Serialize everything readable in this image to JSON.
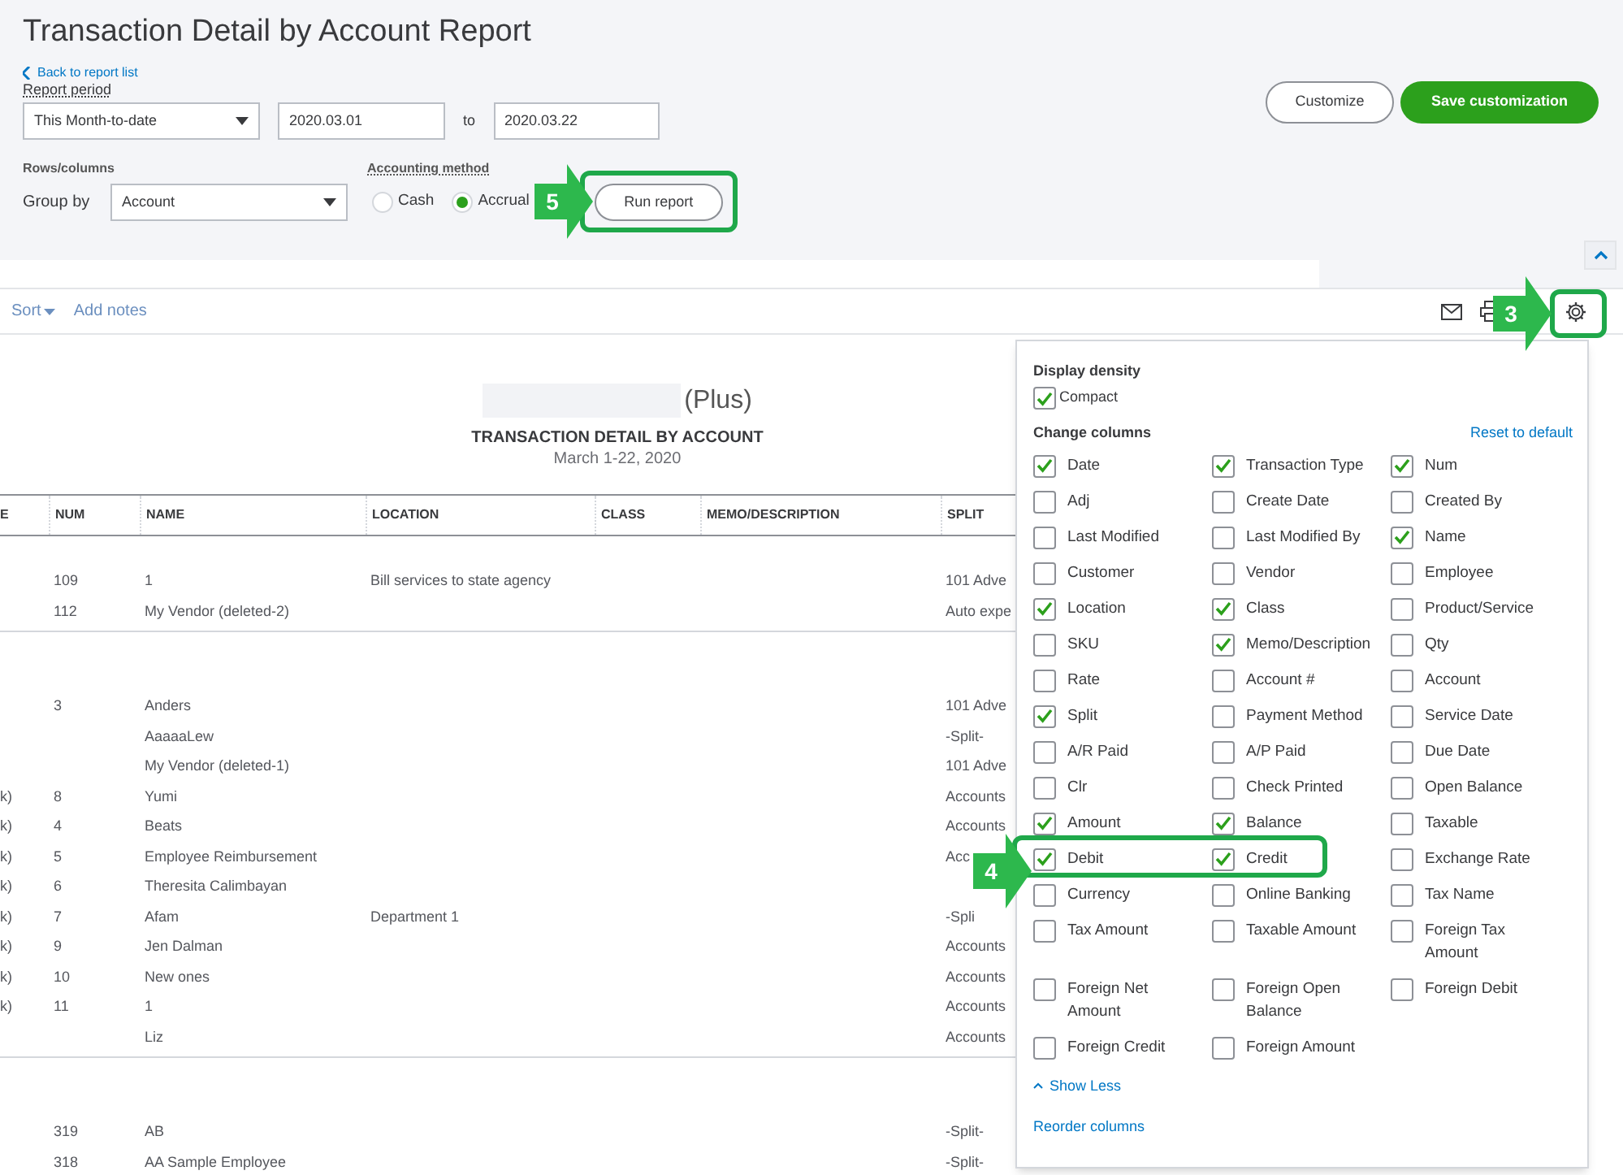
{
  "header": {
    "title": "Transaction Detail by Account Report",
    "back_link": "Back to report list",
    "report_period_label": "Report period",
    "period_select": "This Month-to-date",
    "date_from": "2020.03.01",
    "to_label": "to",
    "date_to": "2020.03.22",
    "rows_columns_label": "Rows/columns",
    "group_by_label": "Group by",
    "group_by_select": "Account",
    "accounting_method_label": "Accounting method",
    "methods": [
      {
        "label": "Cash",
        "selected": false
      },
      {
        "label": "Accrual",
        "selected": true
      }
    ],
    "run_report": "Run report",
    "customize": "Customize",
    "save_customization": "Save customization"
  },
  "toolbar": {
    "sort": "Sort",
    "add_notes": "Add notes"
  },
  "report": {
    "company_suffix": "(Plus)",
    "title": "TRANSACTION DETAIL BY ACCOUNT",
    "subtitle": "March 1-22, 2020"
  },
  "table": {
    "columns": [
      "E",
      "NUM",
      "NAME",
      "LOCATION",
      "CLASS",
      "MEMO/DESCRIPTION",
      "SPLIT"
    ],
    "groups": [
      {
        "rows": [
          [
            "",
            "109",
            "1",
            "Bill services to state agency",
            "",
            "",
            "101 Adve"
          ],
          [
            "",
            "112",
            "My Vendor (deleted-2)",
            "",
            "",
            "",
            "Auto expe"
          ]
        ]
      },
      {
        "rows": [
          [
            "",
            "3",
            "Anders",
            "",
            "",
            "",
            "101 Adve"
          ],
          [
            "",
            "",
            "AaaaaLew",
            "",
            "",
            "",
            "-Split-"
          ],
          [
            "",
            "",
            "My Vendor (deleted-1)",
            "",
            "",
            "",
            "101 Adve"
          ],
          [
            "k)",
            "8",
            "Yumi",
            "",
            "",
            "",
            "Accounts"
          ],
          [
            "k)",
            "4",
            "Beats",
            "",
            "",
            "",
            "Accounts"
          ],
          [
            "k)",
            "5",
            "Employee Reimbursement",
            "",
            "",
            "",
            "Acc"
          ],
          [
            "k)",
            "6",
            "Theresita Calimbayan",
            "",
            "",
            "",
            ""
          ],
          [
            "k)",
            "7",
            "Afam",
            "Department 1",
            "",
            "",
            "-Spli"
          ],
          [
            "k)",
            "9",
            "Jen Dalman",
            "",
            "",
            "",
            "Accounts"
          ],
          [
            "k)",
            "10",
            "New ones",
            "",
            "",
            "",
            "Accounts"
          ],
          [
            "k)",
            "11",
            "1",
            "",
            "",
            "",
            "Accounts"
          ],
          [
            "",
            "",
            "Liz",
            "",
            "",
            "",
            "Accounts"
          ]
        ]
      },
      {
        "rows": [
          [
            "",
            "319",
            "AB",
            "",
            "",
            "",
            "-Split-"
          ],
          [
            "",
            "318",
            "AA Sample Employee",
            "",
            "",
            "",
            "-Split-"
          ]
        ]
      }
    ]
  },
  "settings_popover": {
    "density_label": "Display density",
    "compact": {
      "label": "Compact",
      "checked": true
    },
    "change_columns_label": "Change columns",
    "reset": "Reset to default",
    "options": [
      {
        "label": "Date",
        "checked": true
      },
      {
        "label": "Transaction Type",
        "checked": true
      },
      {
        "label": "Num",
        "checked": true
      },
      {
        "label": "Adj",
        "checked": false
      },
      {
        "label": "Create Date",
        "checked": false
      },
      {
        "label": "Created By",
        "checked": false
      },
      {
        "label": "Last Modified",
        "checked": false
      },
      {
        "label": "Last Modified By",
        "checked": false
      },
      {
        "label": "Name",
        "checked": true
      },
      {
        "label": "Customer",
        "checked": false
      },
      {
        "label": "Vendor",
        "checked": false
      },
      {
        "label": "Employee",
        "checked": false
      },
      {
        "label": "Location",
        "checked": true
      },
      {
        "label": "Class",
        "checked": true
      },
      {
        "label": "Product/Service",
        "checked": false
      },
      {
        "label": "SKU",
        "checked": false
      },
      {
        "label": "Memo/Description",
        "checked": true
      },
      {
        "label": "Qty",
        "checked": false
      },
      {
        "label": "Rate",
        "checked": false
      },
      {
        "label": "Account #",
        "checked": false
      },
      {
        "label": "Account",
        "checked": false
      },
      {
        "label": "Split",
        "checked": true
      },
      {
        "label": "Payment Method",
        "checked": false
      },
      {
        "label": "Service Date",
        "checked": false
      },
      {
        "label": "A/R Paid",
        "checked": false
      },
      {
        "label": "A/P Paid",
        "checked": false
      },
      {
        "label": "Due Date",
        "checked": false
      },
      {
        "label": "Clr",
        "checked": false
      },
      {
        "label": "Check Printed",
        "checked": false
      },
      {
        "label": "Open Balance",
        "checked": false
      },
      {
        "label": "Amount",
        "checked": true
      },
      {
        "label": "Balance",
        "checked": true
      },
      {
        "label": "Taxable",
        "checked": false
      },
      {
        "label": "Debit",
        "checked": true
      },
      {
        "label": "Credit",
        "checked": true
      },
      {
        "label": "Exchange Rate",
        "checked": false
      },
      {
        "label": "Currency",
        "checked": false
      },
      {
        "label": "Online Banking",
        "checked": false
      },
      {
        "label": "Tax Name",
        "checked": false
      },
      {
        "label": "Tax Amount",
        "checked": false
      },
      {
        "label": "Taxable Amount",
        "checked": false
      },
      {
        "label": "Foreign Tax Amount",
        "checked": false
      },
      {
        "label": "Foreign Net Amount",
        "checked": false
      },
      {
        "label": "Foreign Open Balance",
        "checked": false
      },
      {
        "label": "Foreign Debit",
        "checked": false
      },
      {
        "label": "Foreign Credit",
        "checked": false
      },
      {
        "label": "Foreign Amount",
        "checked": false
      }
    ],
    "show_less": "Show Less",
    "reorder": "Reorder columns"
  },
  "annotations": [
    {
      "label": "5"
    },
    {
      "label": "3"
    },
    {
      "label": "4"
    }
  ]
}
